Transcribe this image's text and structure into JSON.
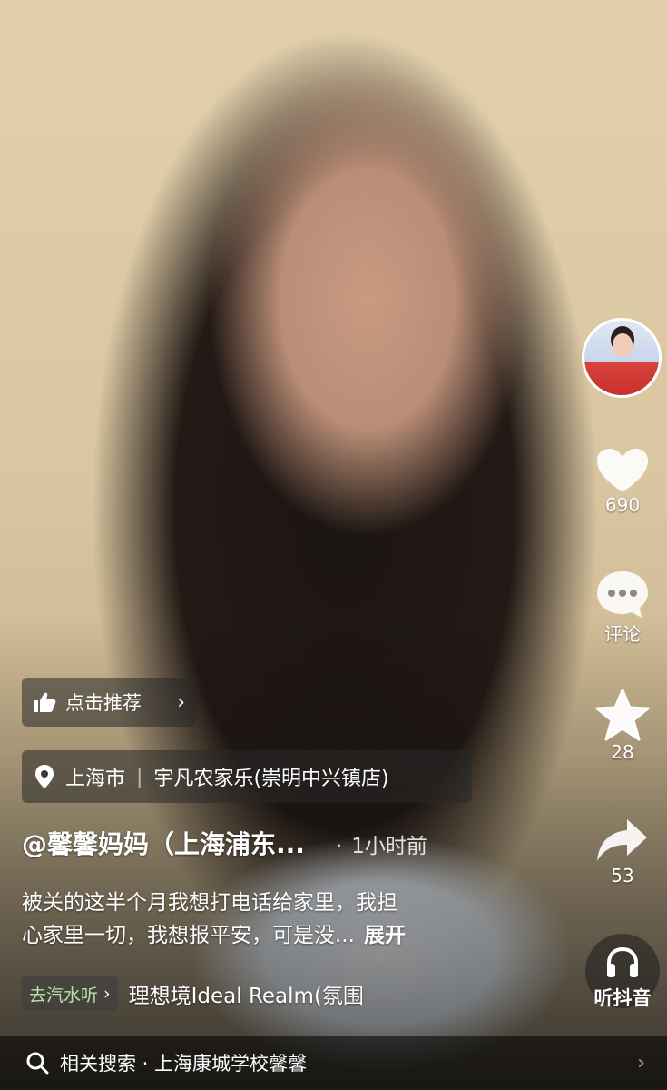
{
  "sidebar": {
    "like_count": "690",
    "comment_label": "评论",
    "favorite_count": "28",
    "share_count": "53",
    "listen_label": "听抖音"
  },
  "recommend": {
    "label": "点击推荐"
  },
  "location": {
    "city": "上海市",
    "place": "宇凡农家乐(崇明中兴镇店)"
  },
  "post": {
    "author": "@馨馨妈妈（上海浦东...",
    "time": "1小时前",
    "description_line1": "被关的这半个月我想打电话给家里，我担",
    "description_line2": "心家里一切，我想报平安，可是没...",
    "expand_label": "展开"
  },
  "music": {
    "button_label": "去汽水听",
    "title": "理想境Ideal Realm(氛围"
  },
  "related_search": {
    "prefix": "相关搜索",
    "query": "上海康城学校馨馨"
  },
  "colors": {
    "music_accent": "#b9e3a9"
  }
}
